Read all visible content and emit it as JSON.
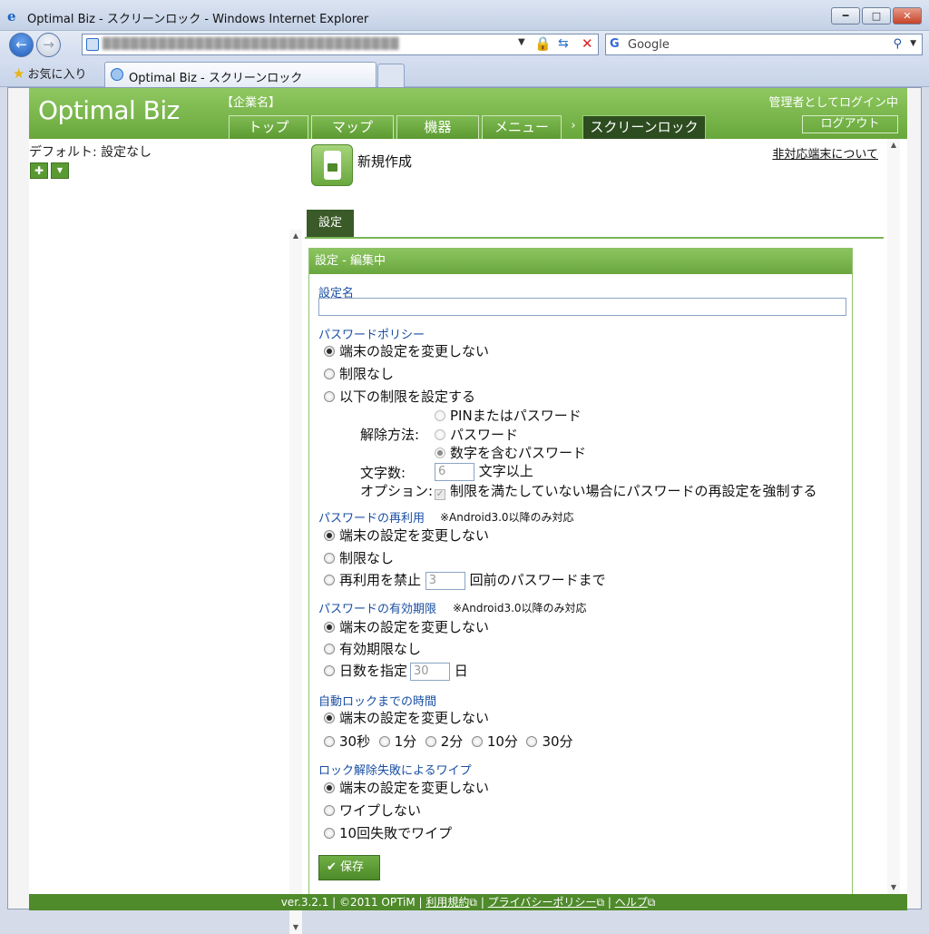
{
  "window": {
    "title": "Optimal Biz - スクリーンロック - Windows Internet Explorer",
    "min": "━",
    "max": "□",
    "close": "✕"
  },
  "browser": {
    "address_icon": "page-icon",
    "search_label": "Google",
    "search_icon": "magnifier-icon",
    "favorites_label": "お気に入り",
    "tab_title": "Optimal Biz - スクリーンロック"
  },
  "header": {
    "logo": "Optimal Biz",
    "company": "【企業名】",
    "admin": "管理者としてログイン中",
    "logout": "ログアウト",
    "nav": [
      "トップ",
      "マップ",
      "機器",
      "メニュー",
      "スクリーンロック"
    ],
    "nav_arrow": "›"
  },
  "sidebar": {
    "default_label": "デフォルト: 設定なし",
    "add": "✚",
    "menu": "▼"
  },
  "main": {
    "new_title": "新規作成",
    "unsupported_link": "非対応端末について",
    "tab": "設定",
    "panel_title": "設定 - 編集中"
  },
  "form": {
    "name_label": "設定名",
    "name_value": "",
    "policy": {
      "label": "パスワードポリシー",
      "options": [
        "端末の設定を変更しない",
        "制限なし",
        "以下の制限を設定する"
      ],
      "unlock_label": "解除方法:",
      "unlock_options": [
        "PINまたはパスワード",
        "パスワード",
        "数字を含むパスワード"
      ],
      "chars_label": "文字数:",
      "chars_value": "6",
      "chars_suffix": "文字以上",
      "option_label": "オプション:",
      "option_text": "制限を満たしていない場合にパスワードの再設定を強制する"
    },
    "reuse": {
      "label": "パスワードの再利用",
      "note": "※Android3.0以降のみ対応",
      "options": [
        "端末の設定を変更しない",
        "制限なし",
        "再利用を禁止"
      ],
      "count_value": "3",
      "count_suffix": "回前のパスワードまで"
    },
    "expiry": {
      "label": "パスワードの有効期限",
      "note": "※Android3.0以降のみ対応",
      "options": [
        "端末の設定を変更しない",
        "有効期限なし",
        "日数を指定"
      ],
      "days_value": "30",
      "days_suffix": "日"
    },
    "autolock": {
      "label": "自動ロックまでの時間",
      "options": [
        "端末の設定を変更しない"
      ],
      "times": [
        "30秒",
        "1分",
        "2分",
        "10分",
        "30分"
      ]
    },
    "wipe": {
      "label": "ロック解除失敗によるワイプ",
      "options": [
        "端末の設定を変更しない",
        "ワイプしない",
        "10回失敗でワイプ"
      ]
    },
    "save": "保存"
  },
  "footer": {
    "version": "ver.3.2.1 | ©2011 OPTiM | ",
    "terms": "利用規約",
    "privacy": "プライバシーポリシー",
    "help": "ヘルプ",
    "sep": " | "
  }
}
